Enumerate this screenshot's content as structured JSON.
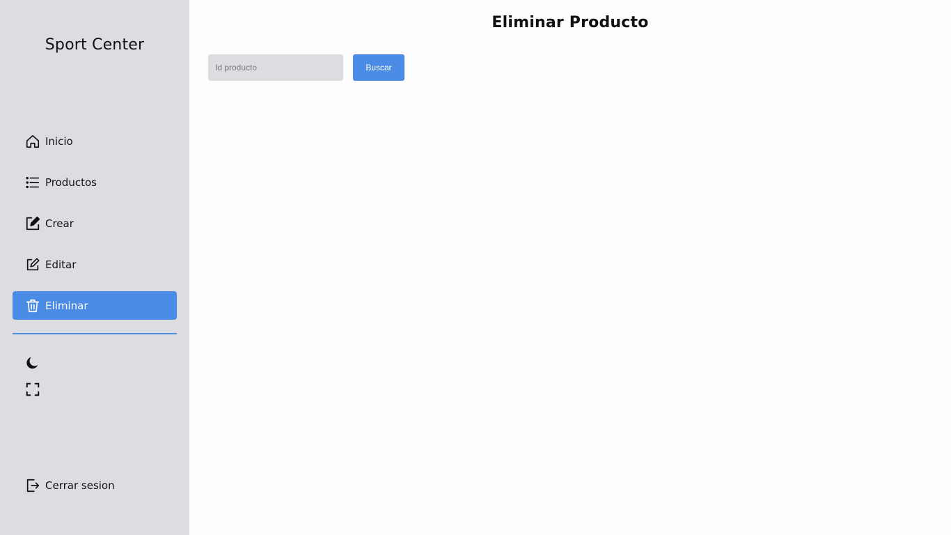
{
  "sidebar": {
    "brand": "Sport Center",
    "items": [
      {
        "label": "Inicio",
        "icon": "home-icon"
      },
      {
        "label": "Productos",
        "icon": "list-icon"
      },
      {
        "label": "Crear",
        "icon": "create-icon"
      },
      {
        "label": "Editar",
        "icon": "edit-icon"
      },
      {
        "label": "Eliminar",
        "icon": "trash-icon",
        "active": true
      }
    ],
    "utilities": [
      {
        "icon": "moon-icon"
      },
      {
        "icon": "fullscreen-icon"
      }
    ],
    "logout": {
      "label": "Cerrar sesion",
      "icon": "logout-icon"
    }
  },
  "main": {
    "title": "Eliminar Producto",
    "search": {
      "placeholder": "Id producto",
      "value": ""
    },
    "button_label": "Buscar"
  },
  "colors": {
    "accent": "#4a8be5",
    "sidebar_bg": "#dcdde1",
    "main_bg": "#fdfdfd"
  }
}
